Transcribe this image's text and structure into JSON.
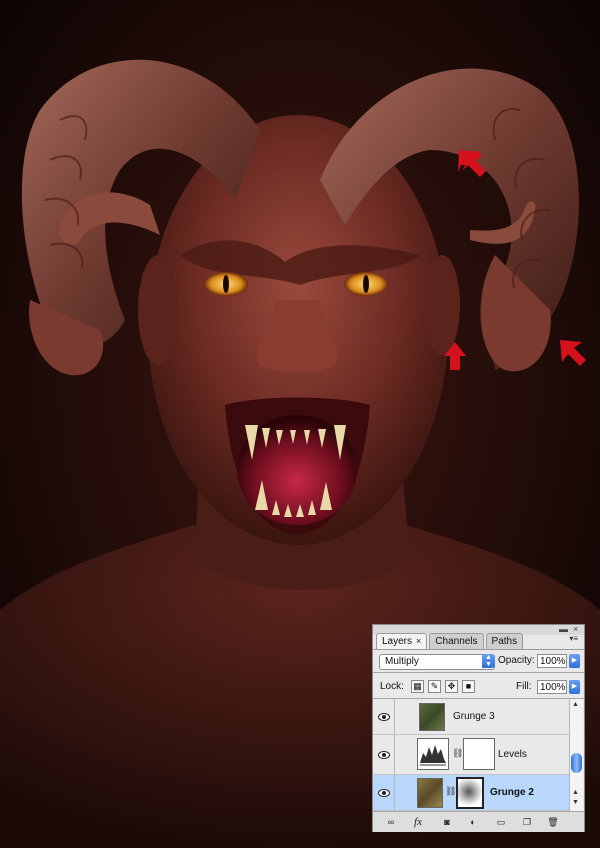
{
  "colors": {
    "arrow": "#d5121b",
    "selected_row": "#b9d6fb",
    "panel_bg": "#e9e9e9",
    "accent_blue": "#2f6fd8"
  },
  "annotations": {
    "arrows": [
      {
        "name": "arrow-upper-right",
        "direction": "down-left"
      },
      {
        "name": "arrow-lower-middle",
        "direction": "up"
      },
      {
        "name": "arrow-lower-right",
        "direction": "up-left"
      }
    ]
  },
  "layers_panel": {
    "tabs": [
      {
        "label": "Layers",
        "active": true,
        "close": "×"
      },
      {
        "label": "Channels",
        "active": false
      },
      {
        "label": "Paths",
        "active": false
      }
    ],
    "window_controls": {
      "collapse": "▬",
      "close": "×"
    },
    "menu_icon": "▾≡",
    "blend_mode": "Multiply",
    "opacity_label": "Opacity:",
    "opacity_value": "100%",
    "lock_label": "Lock:",
    "lock_icons": [
      "lock-transparent-icon",
      "lock-image-icon",
      "lock-position-icon",
      "lock-all-icon"
    ],
    "fill_label": "Fill:",
    "fill_value": "100%",
    "layers": [
      {
        "name": "Grunge 3",
        "visible": true,
        "selected": false,
        "type": "texture"
      },
      {
        "name": "Levels",
        "visible": true,
        "selected": false,
        "type": "adjustment"
      },
      {
        "name": "Grunge 2",
        "visible": true,
        "selected": true,
        "type": "texture"
      }
    ],
    "bottom_icons": [
      "link-icon",
      "fx-icon",
      "mask-icon",
      "adjustment-icon",
      "group-icon",
      "new-layer-icon",
      "trash-icon"
    ],
    "fx_label": "fx"
  }
}
